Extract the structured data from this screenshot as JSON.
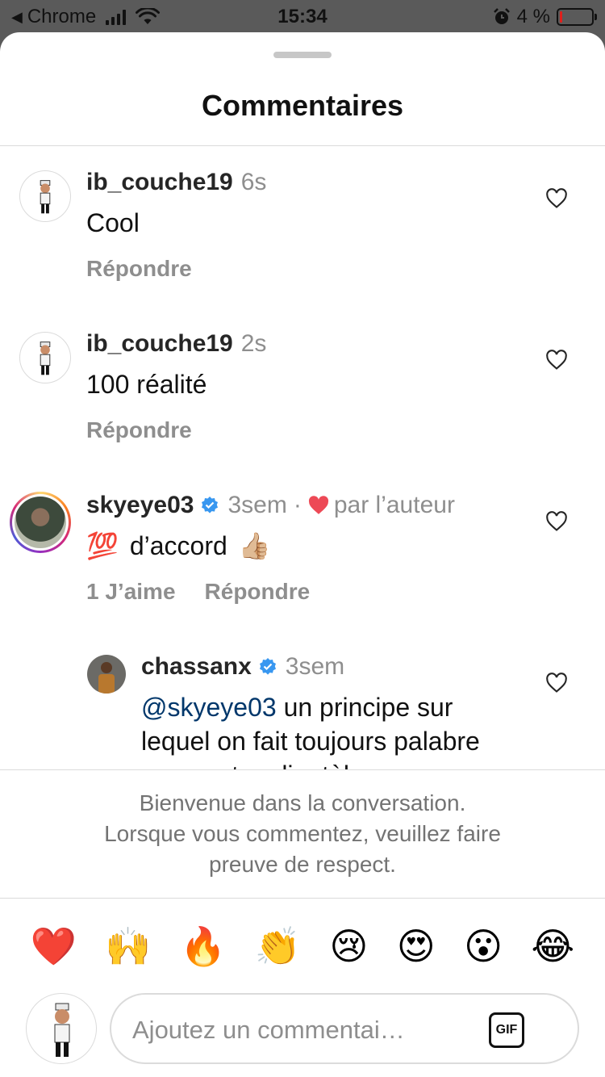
{
  "status_bar": {
    "back_app": "Chrome",
    "time": "15:34",
    "battery": "4 %",
    "battery_color": "#e0201c"
  },
  "sheet": {
    "title": "Commentaires"
  },
  "comments": [
    {
      "username": "ib_couche19",
      "time": "6s",
      "text": "Cool",
      "reply_label": "Répondre"
    },
    {
      "username": "ib_couche19",
      "time": "2s",
      "text": "100 réalité",
      "reply_label": "Répondre"
    },
    {
      "username": "skyeye03",
      "verified": true,
      "time": "3sem",
      "separator": "·",
      "liked_by_author": "par l’auteur",
      "text_emoji_prefix": "💯",
      "text": "d’accord",
      "text_emoji_suffix": "👍🏼",
      "likes_label": "1 J’aime",
      "reply_label": "Répondre"
    },
    {
      "username": "chassanx",
      "verified": true,
      "time": "3sem",
      "mention": "@skyeye03",
      "text": " un principe sur lequel on fait toujours",
      "text_continued": "palabre avec notre clientèle"
    }
  ],
  "welcome": {
    "line1": "Bienvenue dans la conversation.",
    "line2": "Lorsque vous commentez, veuillez faire",
    "line3": "preuve de respect."
  },
  "quick_reactions": [
    "❤️",
    "🙌",
    "🔥",
    "👏",
    "😢",
    "😍",
    "😮",
    "😂"
  ],
  "composer": {
    "placeholder": "Ajoutez un commentai…",
    "gif_label": "GIF"
  },
  "colors": {
    "verified": "#3897f0",
    "heart": "#ed4956",
    "mention": "#00376b"
  },
  "icons": [
    "back-arrow-icon",
    "signal-icon",
    "wifi-icon",
    "alarm-icon",
    "battery-icon",
    "heart-outline-icon",
    "verified-badge-icon",
    "heart-filled-icon",
    "gif-icon"
  ]
}
